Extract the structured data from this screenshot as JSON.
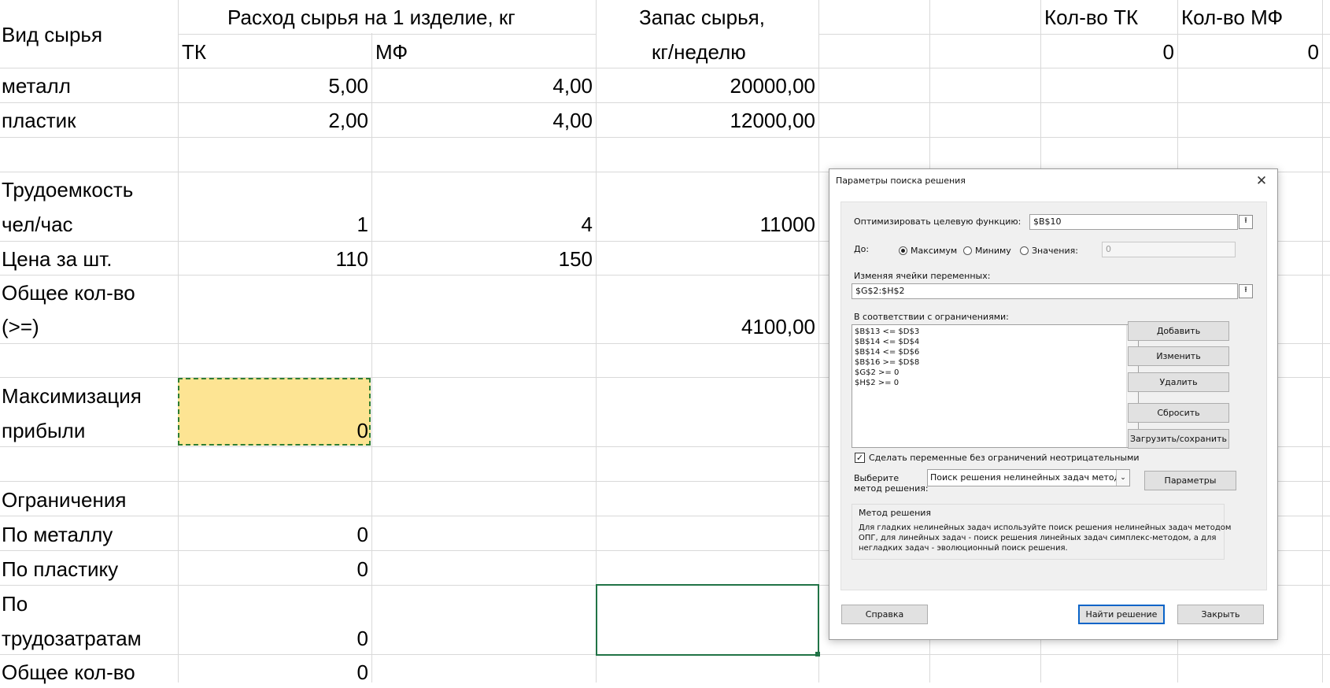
{
  "sheet": {
    "header": {
      "col_a_title": "Вид сырья",
      "usage_title": "Расход сырья на 1 изделие, кг",
      "tk": "ТК",
      "mf": "МФ",
      "stock_title_1": "Запас сырья,",
      "stock_title_2": "кг/неделю",
      "qty_tk_title": "Кол-во ТК",
      "qty_mf_title": "Кол-во МФ",
      "qty_tk_value": "0",
      "qty_mf_value": "0"
    },
    "rows": {
      "metal_label": "металл",
      "metal_tk": "5,00",
      "metal_mf": "4,00",
      "metal_stock": "20000,00",
      "plastic_label": "пластик",
      "plastic_tk": "2,00",
      "plastic_mf": "4,00",
      "plastic_stock": "12000,00",
      "labor_label_1": "Трудоемкость",
      "labor_label_2": "чел/час",
      "labor_tk": "1",
      "labor_mf": "4",
      "labor_stock": "11000",
      "price_label": "Цена за шт.",
      "price_tk": "110",
      "price_mf": "150",
      "total_label_1": "Общее кол-во",
      "total_label_2": "(>=)",
      "total_stock": "4100,00",
      "maxprofit_label_1": "Максимизация",
      "maxprofit_label_2": "прибыли",
      "maxprofit_value": "0",
      "constraints_label": "Ограничения",
      "c_metal_label": "По металлу",
      "c_metal_value": "0",
      "c_plastic_label": "По пластику",
      "c_plastic_value": "0",
      "c_labor_label_1": "По",
      "c_labor_label_2": "трудозатратам",
      "c_labor_value": "0",
      "c_total_label": "Общее кол-во",
      "c_total_value": "0"
    }
  },
  "dialog": {
    "title": "Параметры поиска решения",
    "close_glyph": "✕",
    "objective_label": "Оптимизировать целевую функцию:",
    "objective_value": "$B$10",
    "to_label": "До:",
    "opt_max": "Максимум",
    "opt_min": "Миниму",
    "opt_value": "Значения:",
    "value_field": "0",
    "changing_label": "Изменяя ячейки переменных:",
    "changing_value": "$G$2:$H$2",
    "constraints_label": "В соответствии с ограничениями:",
    "constraints": [
      "$B$13 <= $D$3",
      "$B$14 <= $D$4",
      "$B$14 <= $D$6",
      "$B$16 >= $D$8",
      "$G$2 >= 0",
      "$H$2 >= 0"
    ],
    "btn_add": "Добавить",
    "btn_change": "Изменить",
    "btn_delete": "Удалить",
    "btn_reset": "Сбросить",
    "btn_load_save": "Загрузить/сохранить",
    "nonneg_label": "Сделать переменные без ограничений неотрицательными",
    "nonneg_checked": "✓",
    "method_label_1": "Выберите",
    "method_label_2": "метод решения:",
    "method_value": "Поиск решения нелинейных задач методом ОПГ",
    "btn_params": "Параметры",
    "method_group_title": "Метод решения",
    "method_desc_1": "Для гладких нелинейных задач используйте поиск решения нелинейных задач методом",
    "method_desc_2": "ОПГ, для линейных задач - поиск решения линейных задач симплекс-методом, а для",
    "method_desc_3": "негладких задач - эволюционный поиск решения.",
    "btn_help": "Справка",
    "btn_solve": "Найти решение",
    "btn_close": "Закрыть",
    "collapse_glyph": "⭱",
    "scroll_up": "^",
    "scroll_down": "v",
    "combo_arrow": "⌄"
  }
}
